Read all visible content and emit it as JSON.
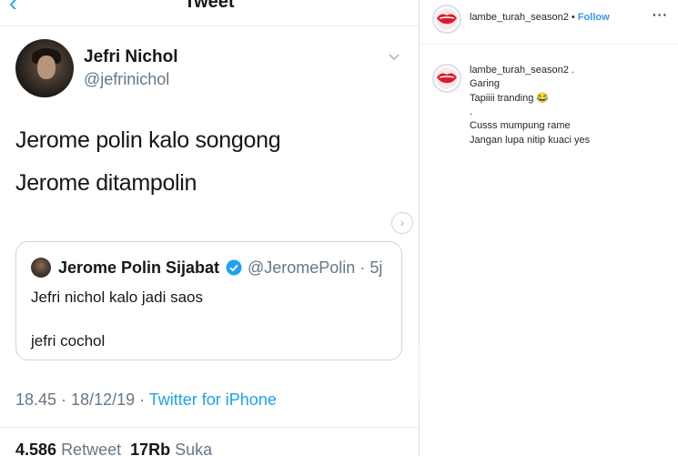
{
  "tweet": {
    "header_title": "Tweet",
    "author_name": "Jefri Nichol",
    "author_handle": "@jefrinichol",
    "lines": [
      "Jerome polin kalo songong",
      "Jerome ditampolin"
    ],
    "quoted": {
      "name": "Jerome Polin Sijabat",
      "meta": "@JeromePolin · 5j",
      "line1": "Jefri nichol kalo jadi saos",
      "line2": "jefri cochol"
    },
    "timestamp": "18.45 · 18/12/19 · ",
    "source": "Twitter for iPhone",
    "retweet_count": "4.586",
    "retweet_label": "Retweet",
    "like_count": "17Rb",
    "like_label": "Suka"
  },
  "instagram": {
    "username": "lambe_turah_season2",
    "follow_sep": " • ",
    "follow_label": "Follow",
    "more_glyph": "···",
    "caption_user": "lambe_turah_season2 .",
    "caption_lines": [
      "Garing",
      "Tapiiii tranding 😂",
      ".",
      "Cusss mumpung rame",
      "Jangan lupa nitip kuaci yes"
    ]
  },
  "colors": {
    "twitter_blue": "#1da1f2",
    "ig_blue": "#3897f0",
    "verified": "#1da1f2"
  }
}
